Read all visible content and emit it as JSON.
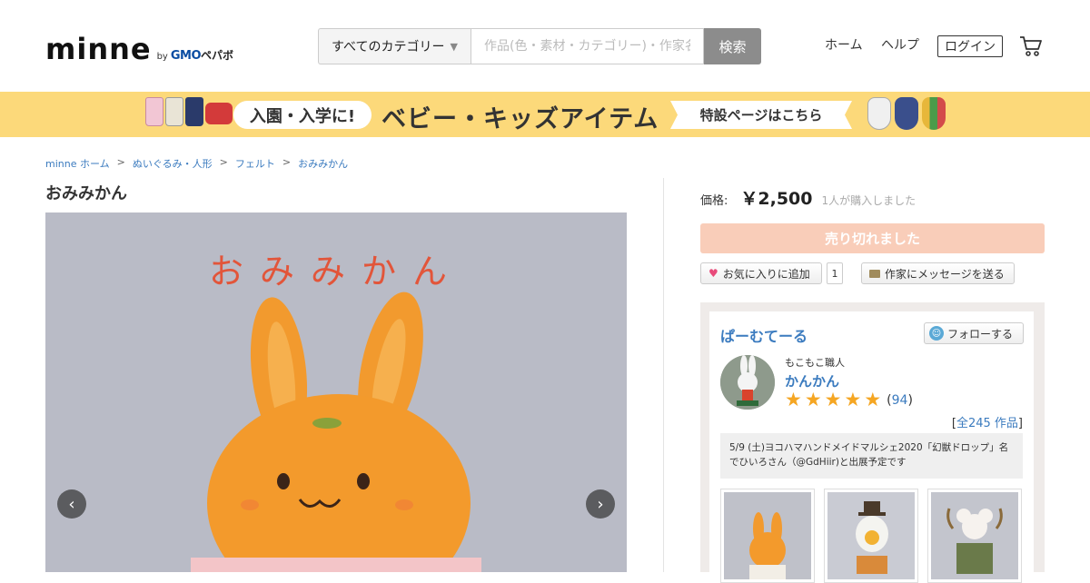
{
  "header": {
    "logo": "minne",
    "logo_by": "by",
    "logo_gmo": "GMO",
    "logo_pepabo": "ペパボ",
    "category_select": "すべてのカテゴリー",
    "search_placeholder": "作品(色・素材・カテゴリー)・作家名で検索",
    "search_button": "検索",
    "nav_home": "ホーム",
    "nav_help": "ヘルプ",
    "nav_login": "ログイン",
    "cart_icon": "cart-icon"
  },
  "banner": {
    "pill": "入園・入学に!",
    "title": "ベビー・キッズアイテム",
    "special": "特設ページはこちら",
    "bag_colors": [
      "#f2c6d4",
      "#e9e4d6",
      "#2a3a6a",
      "#d33a3a"
    ],
    "bib_colors": [
      "#f0f0f0",
      "#3a4f8c",
      "#e7b73a"
    ]
  },
  "breadcrumb": {
    "items": [
      "minne ホーム",
      "ぬいぐるみ・人形",
      "フェルト",
      "おみみかん"
    ],
    "separator": ">"
  },
  "product": {
    "title": "おみみかん",
    "image_caption": "おみみかん",
    "price_label": "価格:",
    "price": "￥2,500",
    "purchase_count": "1人が購入しました",
    "soldout": "売り切れました",
    "favorite_label": "お気に入りに追加",
    "favorite_count": "1",
    "message_label": "作家にメッセージを送る"
  },
  "shop": {
    "name": "ぱーむてーる",
    "follow_label": "フォローする",
    "creator_title": "もこもこ職人",
    "creator_name": "かんかん",
    "rating": 5,
    "review_count_open": "(",
    "review_count": "94",
    "review_count_close": ")",
    "all_works_open": "[",
    "all_works": "全245 作品",
    "all_works_close": "]",
    "notice": "5/9 (土)ヨコハマハンドメイドマルシェ2020「幻獣ドロップ」名でひいろさん（@GdHiir)と出展予定です"
  },
  "colors": {
    "accent_link": "#3b7bbf",
    "banner_bg": "#fcd97a",
    "soldout_bg": "#f9cdb9",
    "star": "#f5a623"
  }
}
